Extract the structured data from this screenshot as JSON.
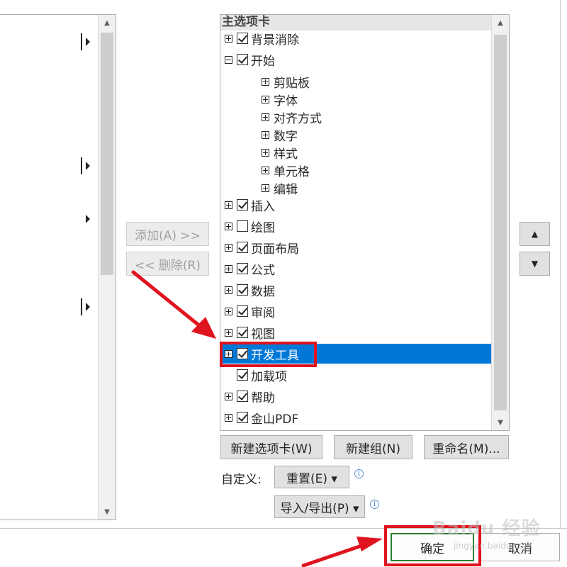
{
  "middle": {
    "add_label": "添加(A) >>",
    "remove_label": "<< 删除(R)"
  },
  "tree": {
    "header": "主选项卡",
    "items": [
      {
        "label": "背景消除",
        "expand": "plus",
        "checked": true,
        "level": 0
      },
      {
        "label": "开始",
        "expand": "minus",
        "checked": true,
        "level": 0
      },
      {
        "label": "剪贴板",
        "expand": "plus",
        "level": 1
      },
      {
        "label": "字体",
        "expand": "plus",
        "level": 1
      },
      {
        "label": "对齐方式",
        "expand": "plus",
        "level": 1
      },
      {
        "label": "数字",
        "expand": "plus",
        "level": 1
      },
      {
        "label": "样式",
        "expand": "plus",
        "level": 1
      },
      {
        "label": "单元格",
        "expand": "plus",
        "level": 1
      },
      {
        "label": "编辑",
        "expand": "plus",
        "level": 1
      },
      {
        "label": "插入",
        "expand": "plus",
        "checked": true,
        "level": 0
      },
      {
        "label": "绘图",
        "expand": "plus",
        "checked": false,
        "level": 0
      },
      {
        "label": "页面布局",
        "expand": "plus",
        "checked": true,
        "level": 0
      },
      {
        "label": "公式",
        "expand": "plus",
        "checked": true,
        "level": 0
      },
      {
        "label": "数据",
        "expand": "plus",
        "checked": true,
        "level": 0
      },
      {
        "label": "审阅",
        "expand": "plus",
        "checked": true,
        "level": 0
      },
      {
        "label": "视图",
        "expand": "plus",
        "checked": true,
        "level": 0
      },
      {
        "label": "开发工具",
        "expand": "plus",
        "checked": true,
        "level": 0,
        "selected": true
      },
      {
        "label": "加载项",
        "expand": "none",
        "checked": true,
        "level": 0
      },
      {
        "label": "帮助",
        "expand": "plus",
        "checked": true,
        "level": 0
      },
      {
        "label": "金山PDF",
        "expand": "plus",
        "checked": true,
        "level": 0
      }
    ]
  },
  "tree_buttons": {
    "new_tab": "新建选项卡(W)",
    "new_group": "新建组(N)",
    "rename": "重命名(M)..."
  },
  "customize": {
    "label": "自定义:",
    "reset": "重置(E) ▾",
    "import_export": "导入/导出(P) ▾"
  },
  "footer": {
    "ok": "确定",
    "cancel": "取消"
  },
  "watermark": {
    "main": "Baidu 经验",
    "sub": "jingyan.baidu.com"
  },
  "colors": {
    "selection": "#0078d7",
    "highlight_red": "#e0141e",
    "ok_border": "#2e7d32"
  }
}
